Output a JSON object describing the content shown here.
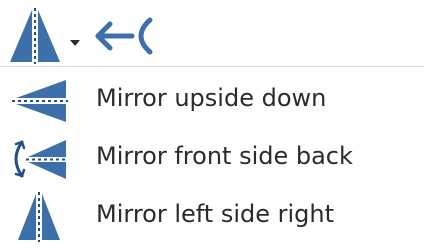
{
  "toolbar": {
    "mirror_button_icon": "mirror-left-right-icon",
    "dropdown_icon": "dropdown-arrow-icon",
    "back_icon": "back-arrow-icon"
  },
  "menu": {
    "items": [
      {
        "label": "Mirror upside down",
        "icon": "mirror-upside-down-icon"
      },
      {
        "label": "Mirror front side back",
        "icon": "mirror-front-back-icon"
      },
      {
        "label": "Mirror left side right",
        "icon": "mirror-left-right-icon"
      }
    ]
  },
  "colors": {
    "icon_blue": "#3d6fa8",
    "icon_dark": "#1f4f8a",
    "text": "#2b2b2b"
  }
}
